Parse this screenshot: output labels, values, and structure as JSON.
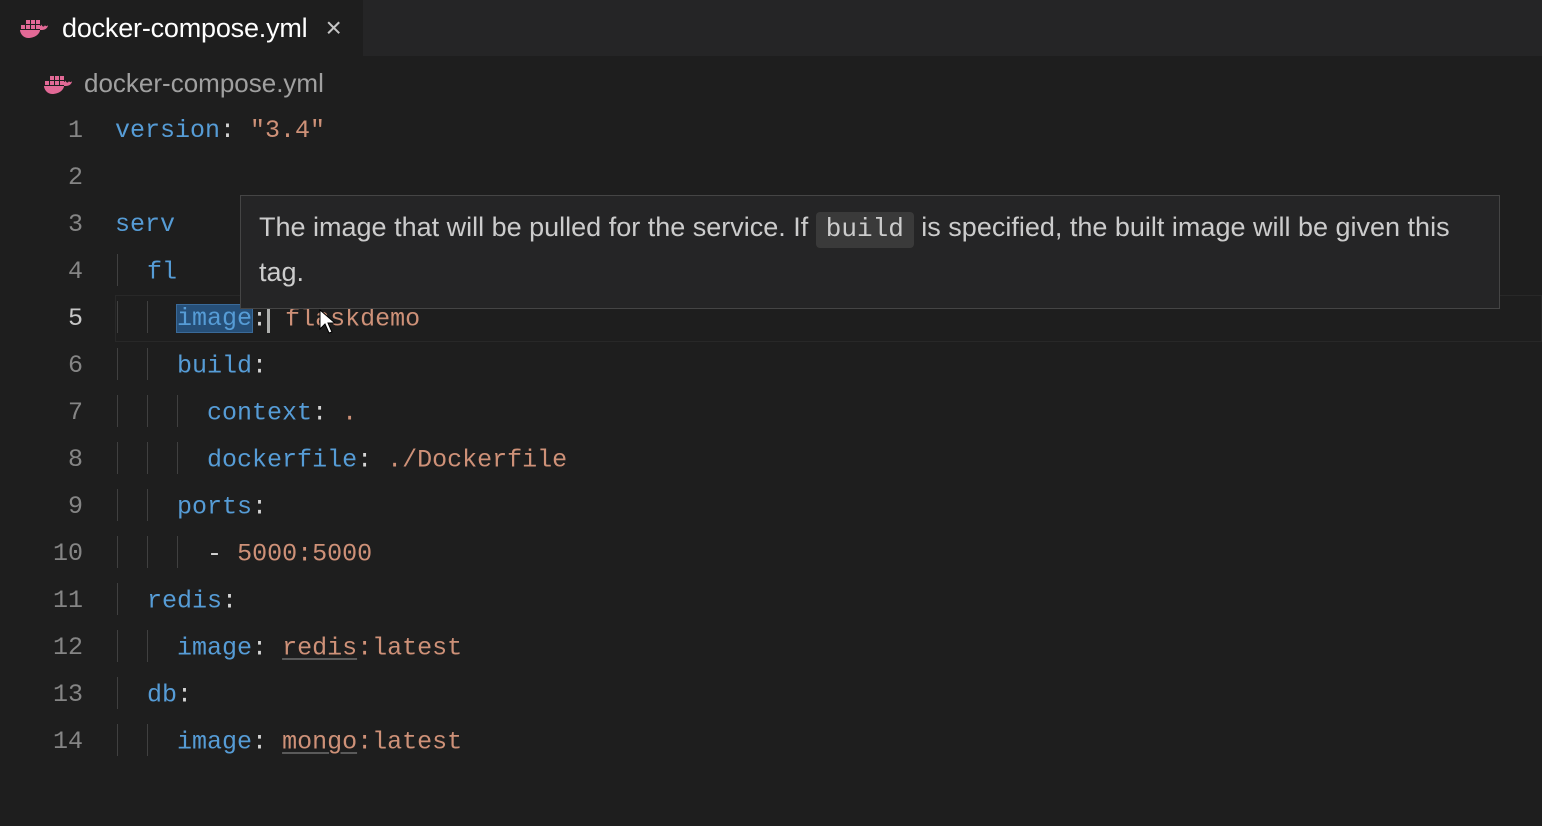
{
  "tab": {
    "title": "docker-compose.yml"
  },
  "breadcrumb": {
    "title": "docker-compose.yml"
  },
  "hover": {
    "pre": "The image that will be pulled for the service. If ",
    "code": "build",
    "post": " is specified, the built image will be given this tag."
  },
  "code": {
    "l1_key": "version",
    "l1_val": "\"3.4\"",
    "l3_key": "serv",
    "l4_key": "fl",
    "l5_key": "image",
    "l5_val": "flaskdemo",
    "l6_key": "build",
    "l7_key": "context",
    "l7_val": ".",
    "l8_key": "dockerfile",
    "l8_val": "./Dockerfile",
    "l9_key": "ports",
    "l10_val": "5000:5000",
    "l11_key": "redis",
    "l12_key": "image",
    "l12_val_a": "redis",
    "l12_val_b": ":latest",
    "l13_key": "db",
    "l14_key": "image",
    "l14_val_a": "mongo",
    "l14_val_b": ":latest"
  },
  "line_numbers": [
    "1",
    "2",
    "3",
    "4",
    "5",
    "6",
    "7",
    "8",
    "9",
    "10",
    "11",
    "12",
    "13",
    "14"
  ]
}
